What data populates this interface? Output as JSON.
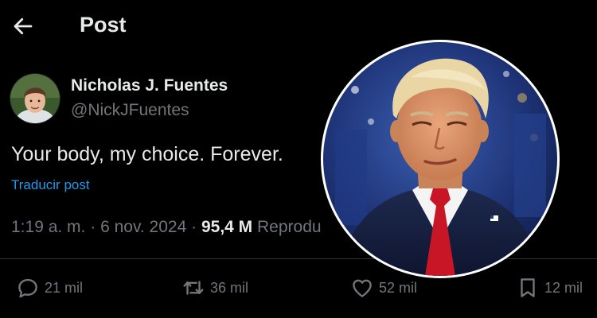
{
  "header": {
    "title": "Post",
    "back_icon": "arrow-left-icon"
  },
  "author": {
    "display_name": "Nicholas J. Fuentes",
    "handle": "@NickJFuentes"
  },
  "post": {
    "text": "Your body, my choice. Forever.",
    "translate_label": "Traducir post"
  },
  "meta": {
    "time": "1:19 a. m.",
    "separator": "·",
    "date": "6 nov. 2024",
    "views_count": "95,4 M",
    "views_label": "Reprodu"
  },
  "actions": {
    "replies": {
      "icon": "reply-icon",
      "count": "21 mil"
    },
    "reposts": {
      "icon": "repost-icon",
      "count": "36 mil"
    },
    "likes": {
      "icon": "heart-icon",
      "count": "52 mil"
    },
    "bookmarks": {
      "icon": "bookmark-icon",
      "count": "12 mil"
    }
  },
  "colors": {
    "background": "#000000",
    "text_primary": "#e7e9ea",
    "text_secondary": "#71767b",
    "link": "#1d9bf0",
    "divider": "#2f3336"
  }
}
